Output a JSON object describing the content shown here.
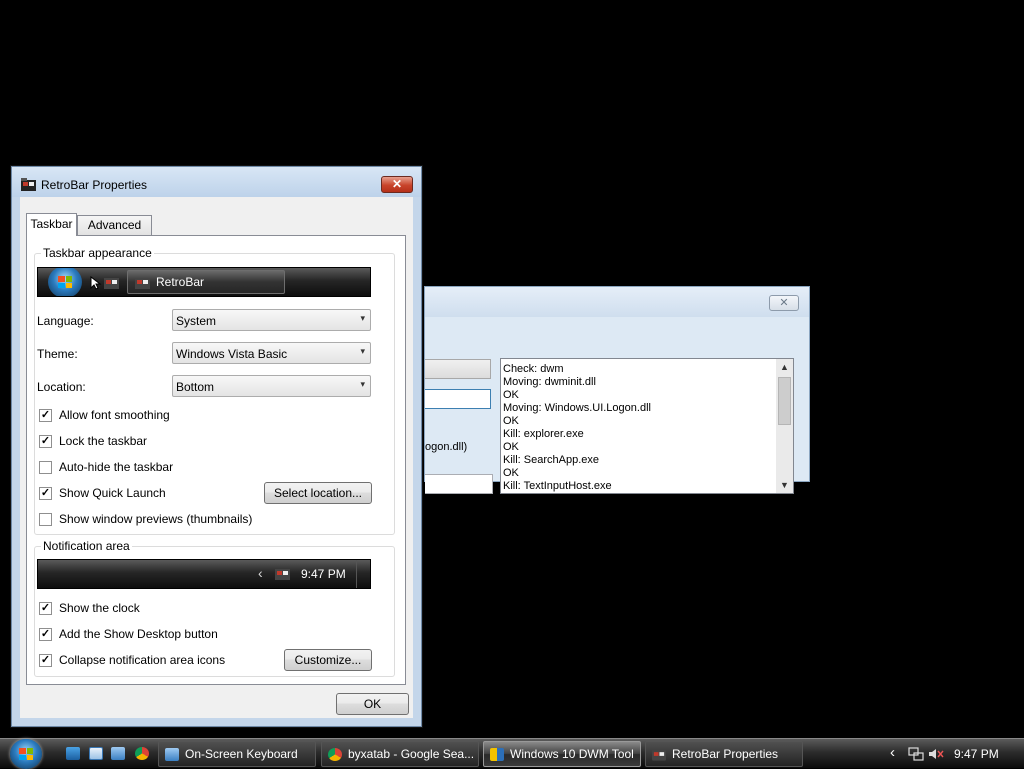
{
  "background_window": {
    "close_glyph": "✕",
    "fragment_text": "ogon.dll)",
    "log_lines": [
      "Check: dwm",
      "Moving: dwminit.dll",
      "OK",
      "Moving: Windows.UI.Logon.dll",
      "OK",
      "Kill: explorer.exe",
      "OK",
      "Kill: SearchApp.exe",
      "OK",
      "Kill: TextInputHost.exe"
    ]
  },
  "dialog": {
    "title": "RetroBar Properties",
    "close_glyph": "✕",
    "tabs": [
      "Taskbar",
      "Advanced"
    ],
    "appearance": {
      "legend": "Taskbar appearance",
      "preview_button": "RetroBar",
      "language_label": "Language:",
      "language_value": "System",
      "theme_label": "Theme:",
      "theme_value": "Windows Vista Basic",
      "location_label": "Location:",
      "location_value": "Bottom",
      "checkboxes": [
        {
          "label": "Allow font smoothing",
          "checked": true
        },
        {
          "label": "Lock the taskbar",
          "checked": true
        },
        {
          "label": "Auto-hide the taskbar",
          "checked": false
        },
        {
          "label": "Show Quick Launch",
          "checked": true
        },
        {
          "label": "Show window previews (thumbnails)",
          "checked": false
        }
      ],
      "select_location_button": "Select location..."
    },
    "notification": {
      "legend": "Notification area",
      "preview_time": "9:47 PM",
      "chevron": "‹",
      "checkboxes": [
        {
          "label": "Show the clock",
          "checked": true
        },
        {
          "label": "Add the Show Desktop button",
          "checked": true
        },
        {
          "label": "Collapse notification area icons",
          "checked": true
        }
      ],
      "customize_button": "Customize..."
    },
    "ok_button": "OK",
    "check_mark": "✓",
    "dropdown_arrow": "▾"
  },
  "taskbar": {
    "buttons": [
      {
        "label": "On-Screen Keyboard",
        "icon": "keyboard-icon",
        "active": false
      },
      {
        "label": "byxatab - Google Sea...",
        "icon": "chrome-icon",
        "active": false
      },
      {
        "label": "Windows 10 DWM Tool",
        "icon": "dwm-tool-icon",
        "active": true
      },
      {
        "label": "RetroBar Properties",
        "icon": "retrobar-icon",
        "active": false
      }
    ],
    "clock": "9:47 PM",
    "tray_chevron": "‹"
  },
  "colors": {
    "close_red": "#c8442b",
    "desktop": "#000000",
    "frame_blue": "#c4d6ea"
  }
}
